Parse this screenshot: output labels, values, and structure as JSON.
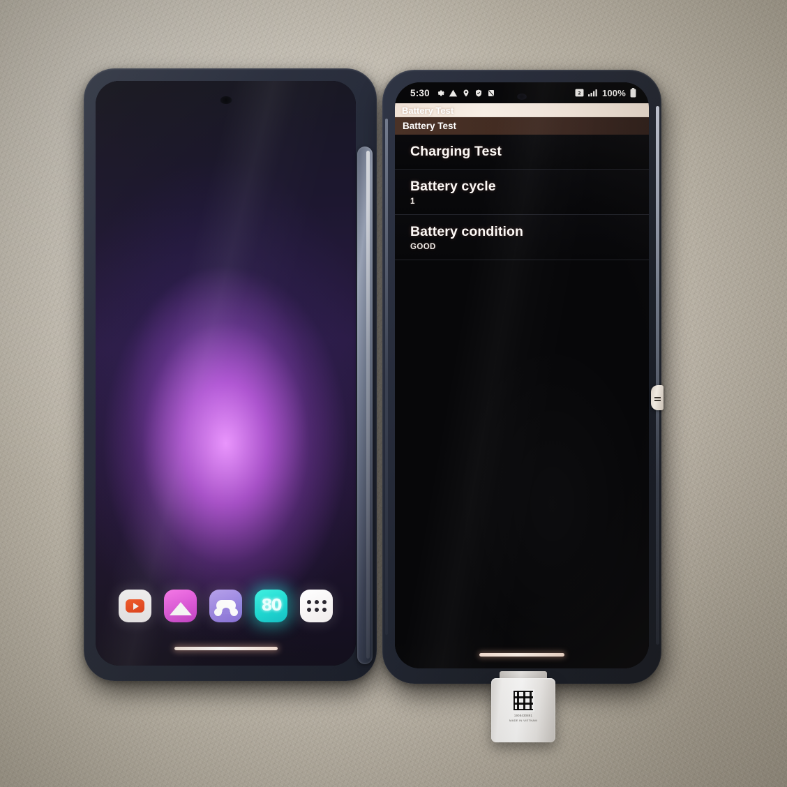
{
  "photo": {
    "description": "Photograph of two folding-phone halves lying on a textured beige mat, the right screen showing an Android Battery Test diagnostic menu",
    "background_color": "#c6bfb2"
  },
  "left_phone": {
    "name": "left-phone",
    "wallpaper": {
      "description": "purple-magenta radial glow wallpaper",
      "glow_color": "#ec96ff",
      "base_color": "#2a1b44"
    },
    "dock": {
      "items": [
        {
          "icon": "youtube-icon",
          "label": "YouTube",
          "color": "#e8390f"
        },
        {
          "icon": "gallery-icon",
          "label": "Gallery",
          "color": "#e159dd"
        },
        {
          "icon": "games-icon",
          "label": "Games",
          "color": "#9b85e2"
        },
        {
          "icon": "app-80-icon",
          "label": "80",
          "color": "#1fd9d2"
        },
        {
          "icon": "app-drawer-icon",
          "label": "Apps",
          "color": "#ffffff"
        }
      ]
    },
    "home_indicator": "home-gesture-bar"
  },
  "right_phone": {
    "name": "right-phone",
    "status_bar": {
      "clock": "5:30",
      "left_icons": [
        "settings-gear-icon",
        "warning-triangle-icon",
        "location-pin-icon",
        "shield-check-icon",
        "sync-disabled-icon"
      ],
      "right_icons": [
        "dual-sim-icon",
        "signal-bars-icon"
      ],
      "battery_percent": "100%",
      "battery_icon": "battery-full-icon"
    },
    "app": {
      "ghost_title": "Battery Test",
      "title": "Battery Test",
      "accent_title_bg": "#432c22",
      "accent_ghost_bg": "#fbf2e9"
    },
    "settings_list": [
      {
        "title": "Charging Test",
        "value": ""
      },
      {
        "title": "Battery cycle",
        "value": "1"
      },
      {
        "title": "Battery condition",
        "value": "GOOD"
      }
    ],
    "edge_tab": "edge-sticker-tab",
    "home_indicator": "home-gesture-bar"
  },
  "adapter": {
    "name": "usb-c-adapter",
    "code_label": "datamatrix-code",
    "text_line_1": "1908430891",
    "text_line_2": "MADE IN VIETNAM"
  }
}
